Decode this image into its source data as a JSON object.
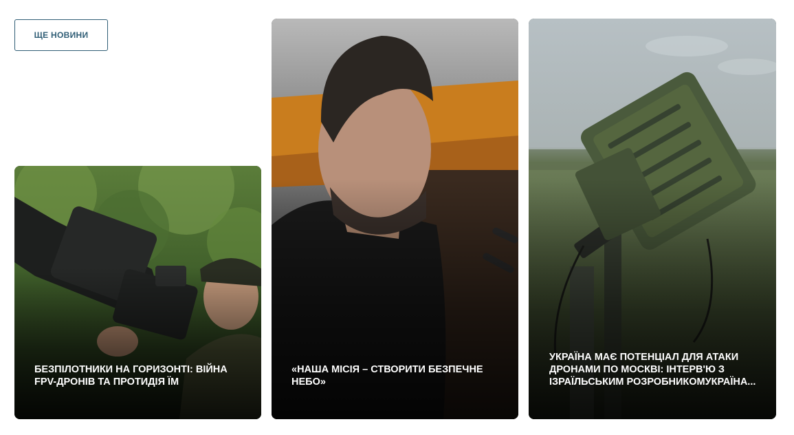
{
  "more_news": {
    "label": "ЩЕ НОВИНИ"
  },
  "cards": [
    {
      "title": "БЕЗПІЛОТНИКИ НА ГОРИЗОНТІ: ВІЙНА FPV-ДРОНІВ ТА ПРОТИДІЯ ЇМ"
    },
    {
      "title": "«НАША МІСІЯ – СТВОРИТИ БЕЗПЕЧНЕ НЕБО»"
    },
    {
      "title": "УКРАЇНА МАЄ ПОТЕНЦІАЛ ДЛЯ АТАКИ ДРОНАМИ ПО МОСКВІ: ІНТЕРВ'Ю З ІЗРАЇЛЬСЬКИМ РОЗРОБНИКОМУКРАЇНА..."
    }
  ],
  "colors": {
    "accent": "#2f5d75",
    "title_text": "#ffffff"
  }
}
